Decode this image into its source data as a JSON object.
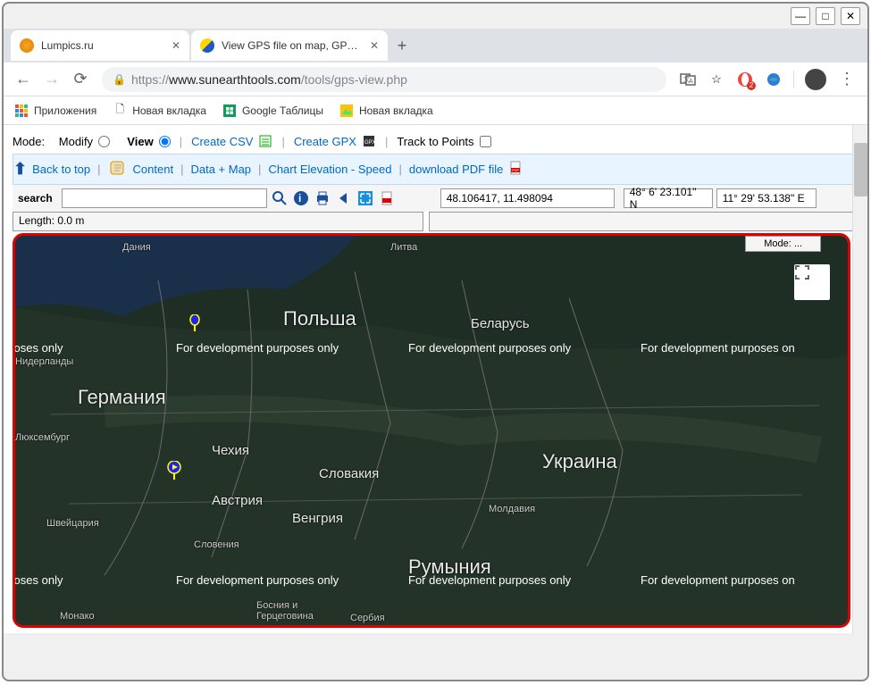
{
  "window": {
    "min": "—",
    "max": "□",
    "close": "✕"
  },
  "tabs": [
    {
      "title": "Lumpics.ru",
      "favicon": "#f5a623"
    },
    {
      "title": "View GPS file on map, GPX, KML",
      "favicon": "#ffd700"
    }
  ],
  "newTab": "+",
  "address": {
    "proto": "https://",
    "host": "www.sunearthtools.com",
    "path": "/tools/gps-view.php"
  },
  "bookmarks": [
    {
      "label": "Приложения"
    },
    {
      "label": "Новая вкладка"
    },
    {
      "label": "Google Таблицы"
    },
    {
      "label": "Новая вкладка"
    }
  ],
  "modeRow": {
    "modeLabel": "Mode:",
    "modify": "Modify",
    "view": "View",
    "createCSV": "Create CSV",
    "createGPX": "Create GPX",
    "trackToPoints": "Track to Points"
  },
  "navLinks": {
    "backToTop": "Back to top",
    "content": "Content",
    "dataMap": "Data + Map",
    "chartElevation": "Chart Elevation - Speed",
    "downloadPDF": "download PDF file"
  },
  "search": {
    "label": "search",
    "value": ""
  },
  "coords": {
    "decimal": "48.106417, 11.498094",
    "dmsLat": "48° 6' 23.101\" N",
    "dmsLon": "11° 29' 53.138\" E"
  },
  "length": "Length: 0.0 m",
  "map": {
    "modeBadge": "Mode: ...",
    "watermark": "For development purposes only",
    "watermarkShort": "ment purposes only",
    "watermarkCut": "For development purposes on",
    "labels": {
      "dania": "Дания",
      "litva": "Литва",
      "polsha": "Польша",
      "belarus": "Беларусь",
      "germania": "Германия",
      "niderlandy": "Нидерланды",
      "luxemburg": "Люксембург",
      "chehia": "Чехия",
      "slovakia": "Словакия",
      "ukraina": "Украина",
      "avstria": "Австрия",
      "vengria": "Венгрия",
      "moldavia": "Молдавия",
      "shveicaria": "Швейцария",
      "slovenia": "Словения",
      "rumynia": "Румыния",
      "monako": "Монако",
      "bosnia": "Босния и\nГерцеговина",
      "serbia": "Сербия"
    }
  }
}
